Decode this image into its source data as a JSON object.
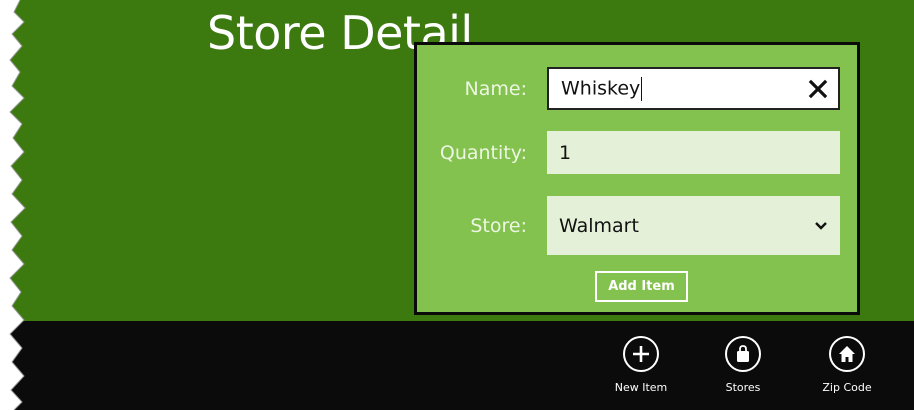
{
  "page": {
    "title": "Store Detail"
  },
  "flyout": {
    "name_label": "Name:",
    "name_value": "Whiskey",
    "quantity_label": "Quantity:",
    "quantity_value": "1",
    "store_label": "Store:",
    "store_selected": "Walmart",
    "add_button_label": "Add Item"
  },
  "appbar": {
    "buttons": [
      {
        "label": "New Item",
        "icon": "plus-icon"
      },
      {
        "label": "Stores",
        "icon": "shopping-bag-icon"
      },
      {
        "label": "Zip Code",
        "icon": "home-icon"
      }
    ]
  },
  "colors": {
    "main_bg": "#3c7a10",
    "flyout_bg": "#84c24f",
    "bottom_bar": "#0b0b0b"
  }
}
